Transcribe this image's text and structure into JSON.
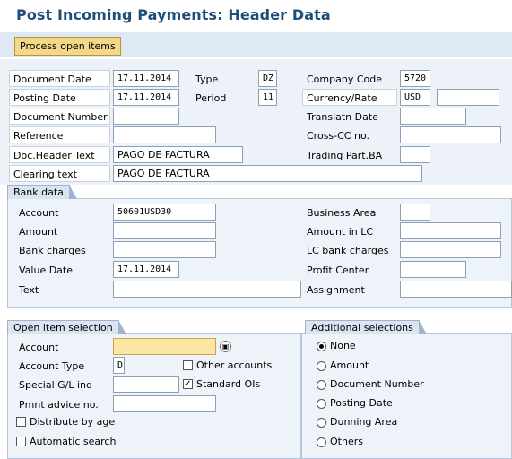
{
  "title": "Post Incoming Payments: Header Data",
  "toolbar": {
    "process_open_items": "Process open items"
  },
  "header": {
    "document_date_label": "Document Date",
    "document_date": "17.11.2014",
    "type_label": "Type",
    "type": "DZ",
    "company_code_label": "Company Code",
    "company_code": "5720",
    "posting_date_label": "Posting Date",
    "posting_date": "17.11.2014",
    "period_label": "Period",
    "period": "11",
    "currency_label": "Currency/Rate",
    "currency": "USD",
    "rate": "",
    "document_number_label": "Document Number",
    "document_number": "",
    "translation_date_label": "Translatn Date",
    "translation_date": "",
    "reference_label": "Reference",
    "reference": "",
    "cross_cc_label": "Cross-CC no.",
    "cross_cc": "",
    "doc_header_text_label": "Doc.Header Text",
    "doc_header_text": "PAGO DE FACTURA",
    "trading_part_label": "Trading Part.BA",
    "trading_part": "",
    "clearing_text_label": "Clearing text",
    "clearing_text": "PAGO DE FACTURA"
  },
  "bank": {
    "tab": "Bank data",
    "account_label": "Account",
    "account": "50601USD30",
    "business_area_label": "Business Area",
    "business_area": "",
    "amount_label": "Amount",
    "amount": "",
    "amount_lc_label": "Amount in LC",
    "amount_lc": "",
    "bank_charges_label": "Bank charges",
    "bank_charges": "",
    "lc_bank_charges_label": "LC bank charges",
    "lc_bank_charges": "",
    "value_date_label": "Value Date",
    "value_date": "17.11.2014",
    "profit_center_label": "Profit Center",
    "profit_center": "",
    "text_label": "Text",
    "text": "",
    "assignment_label": "Assignment",
    "assignment": ""
  },
  "open_items": {
    "tab": "Open item selection",
    "account_label": "Account",
    "account": "",
    "account_type_label": "Account Type",
    "account_type": "D",
    "other_accounts": "Other accounts",
    "special_gl_label": "Special G/L ind",
    "special_gl": "",
    "standard_ois": "Standard OIs",
    "pmnt_advice_label": "Pmnt advice no.",
    "pmnt_advice": "",
    "distribute_by_age": "Distribute by age",
    "automatic_search": "Automatic search"
  },
  "additional": {
    "tab": "Additional selections",
    "options": [
      "None",
      "Amount",
      "Document Number",
      "Posting Date",
      "Dunning Area",
      "Others"
    ]
  }
}
